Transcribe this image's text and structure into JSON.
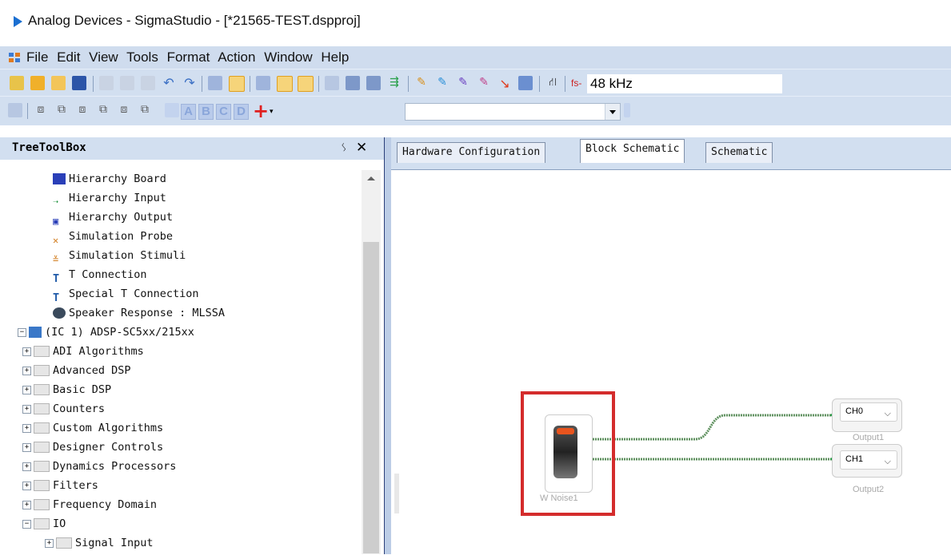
{
  "window": {
    "title": "Analog Devices - SigmaStudio - [*21565-TEST.dspproj]"
  },
  "menubar": {
    "items": [
      "File",
      "Edit",
      "View",
      "Tools",
      "Format",
      "Action",
      "Window",
      "Help"
    ]
  },
  "toolbar": {
    "fs_label": "fs-",
    "fs_value": "48 kHz",
    "letter_buttons": [
      "A",
      "B",
      "C",
      "D"
    ],
    "add_label": "+"
  },
  "toolbox": {
    "title": "TreeToolBox",
    "pin": "ᛊ",
    "close": "✕",
    "items": [
      {
        "label": "Hierarchy Board",
        "icon": "hierarchy-board-icon"
      },
      {
        "label": "Hierarchy Input",
        "icon": "hierarchy-input-icon"
      },
      {
        "label": "Hierarchy Output",
        "icon": "hierarchy-output-icon"
      },
      {
        "label": "Simulation Probe",
        "icon": "simulation-probe-icon"
      },
      {
        "label": "Simulation Stimuli",
        "icon": "simulation-stimuli-icon"
      },
      {
        "label": "T Connection",
        "icon": "t-connection-icon"
      },
      {
        "label": "Special T Connection",
        "icon": "special-t-connection-icon"
      },
      {
        "label": "Speaker Response : MLSSA",
        "icon": "speaker-icon"
      },
      {
        "label": "(IC 1) ADSP-SC5xx/215xx",
        "icon": "chip-icon"
      },
      {
        "label": "ADI Algorithms",
        "icon": "folder-icon"
      },
      {
        "label": "Advanced DSP",
        "icon": "folder-icon"
      },
      {
        "label": "Basic DSP",
        "icon": "folder-icon"
      },
      {
        "label": "Counters",
        "icon": "folder-icon"
      },
      {
        "label": "Custom Algorithms",
        "icon": "folder-icon"
      },
      {
        "label": "Designer Controls",
        "icon": "folder-icon"
      },
      {
        "label": "Dynamics Processors",
        "icon": "folder-icon"
      },
      {
        "label": "Filters",
        "icon": "folder-icon"
      },
      {
        "label": "Frequency Domain",
        "icon": "folder-icon"
      },
      {
        "label": "IO",
        "icon": "folder-icon"
      },
      {
        "label": "Signal Input",
        "icon": "folder-icon"
      }
    ]
  },
  "tabs": [
    "Hardware Configuration",
    "Block Schematic",
    "Schematic"
  ],
  "schematic": {
    "source_block": {
      "label": "W Noise1"
    },
    "outputs": [
      {
        "channel": "CH0",
        "label": "Output1"
      },
      {
        "channel": "CH1",
        "label": "Output2"
      }
    ],
    "wire_color": "#5c8f5c",
    "highlight_color": "#d42c2c"
  }
}
